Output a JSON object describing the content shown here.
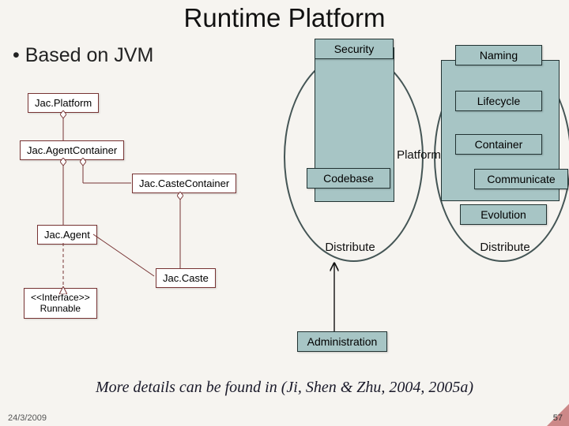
{
  "title": "Runtime Platform",
  "bullet": "• Based on JVM",
  "uml": {
    "platform": "Jac.Platform",
    "agent_container": "Jac.AgentContainer",
    "caste_container": "Jac.CasteContainer",
    "agent": "Jac.Agent",
    "caste": "Jac.Caste",
    "runnable_stereotype": "<<Interface>>",
    "runnable": "Runnable"
  },
  "blocks": {
    "security": "Security",
    "naming": "Naming",
    "lifecycle": "Lifecycle",
    "platform_lbl": "Platform",
    "container": "Container",
    "codebase": "Codebase",
    "communicate": "Communicate",
    "evolution": "Evolution",
    "distribute_l": "Distribute",
    "distribute_r": "Distribute",
    "administration": "Administration"
  },
  "citation": "More details can be found in (Ji, Shen & Zhu, 2004, 2005a)",
  "footer": {
    "date": "24/3/2009",
    "page": "57"
  }
}
